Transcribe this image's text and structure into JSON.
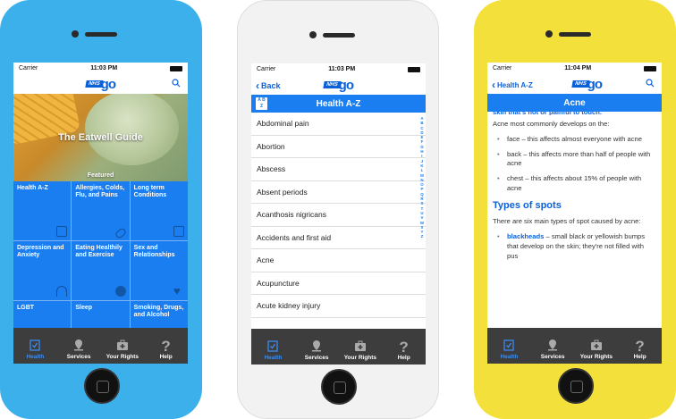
{
  "colors": {
    "accent": "#1a7df0",
    "phone1_frame": "#3cb0ea",
    "phone2_frame": "#f5f5f5",
    "phone3_frame": "#f4e03a",
    "tabbar": "#3d3d3d"
  },
  "status": {
    "carrier": "Carrier",
    "time1": "11:03 PM",
    "time2": "11:03 PM",
    "time3": "11:04 PM"
  },
  "logo": {
    "nhs": "NHS",
    "go": "go"
  },
  "tabs": [
    {
      "label": "Health",
      "icon": "clipboard-icon"
    },
    {
      "label": "Services",
      "icon": "location-pin-icon"
    },
    {
      "label": "Your Rights",
      "icon": "first-aid-kit-icon"
    },
    {
      "label": "Help",
      "icon": "question-mark-icon"
    }
  ],
  "home": {
    "hero_title": "The Eatwell Guide",
    "hero_caption": "Featured",
    "tiles": [
      {
        "label": "Health A-Z",
        "icon": "az-icon"
      },
      {
        "label": "Allergies, Colds, Flu, and Pains",
        "icon": "bandage-icon"
      },
      {
        "label": "Long term Conditions",
        "icon": "calendar-icon"
      },
      {
        "label": "Depression and Anxiety",
        "icon": "umbrella-icon"
      },
      {
        "label": "Eating Healthily and Exercise",
        "icon": "apple-icon"
      },
      {
        "label": "Sex and Relationships",
        "icon": "heart-icon"
      },
      {
        "label": "LGBT",
        "icon": "lgbt-icon"
      },
      {
        "label": "Sleep",
        "icon": "sleep-icon"
      },
      {
        "label": "Smoking, Drugs, and Alcohol",
        "icon": "smoking-icon"
      }
    ]
  },
  "az": {
    "back_label": "Back",
    "title": "Health A-Z",
    "items": [
      "Abdominal pain",
      "Abortion",
      "Abscess",
      "Absent periods",
      "Acanthosis nigricans",
      "Accidents and first aid",
      "Acne",
      "Acupuncture",
      "Acute kidney injury"
    ],
    "index_letters": [
      "A",
      "B",
      "C",
      "D",
      "E",
      "F",
      "G",
      "H",
      "I",
      "J",
      "K",
      "L",
      "M",
      "N",
      "O",
      "P",
      "Q",
      "R",
      "S",
      "T",
      "U",
      "V",
      "W",
      "X",
      "Y",
      "Z"
    ]
  },
  "acne": {
    "back_label": "Health A-Z",
    "title": "Acne",
    "cut_text": "skin that's not or painful to touch.",
    "intro": "Acne most commonly develops on the:",
    "bullets": [
      "face – this affects almost everyone with acne",
      "back – this affects more than half of people with acne",
      "chest – this affects about 15% of people with acne"
    ],
    "heading": "Types of spots",
    "types_intro": "There are six main types of spot caused by acne:",
    "type1_keyword": "blackheads",
    "type1_text": " – small black or yellowish bumps that develop on the skin; they're not filled with pus"
  }
}
